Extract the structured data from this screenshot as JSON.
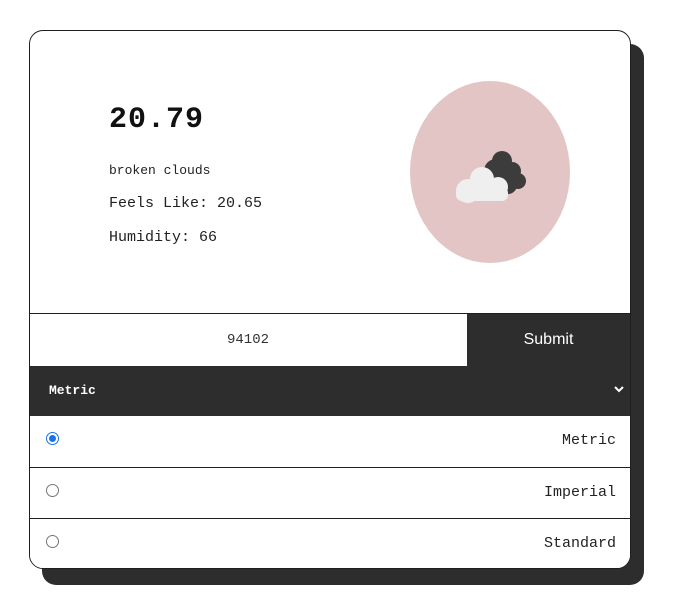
{
  "weather": {
    "temperature": "20.79",
    "description": "broken clouds",
    "feels_like": "Feels Like: 20.65",
    "humidity": "Humidity: 66",
    "icon": "cloud-icon",
    "icon_bg_color": "#e3c5c6"
  },
  "search": {
    "zip_value": "94102",
    "submit_label": "Submit"
  },
  "units": {
    "selected": "Metric",
    "options": [
      {
        "label": "Metric",
        "checked": true
      },
      {
        "label": "Imperial",
        "checked": false
      },
      {
        "label": "Standard",
        "checked": false
      }
    ]
  },
  "colors": {
    "dark": "#2d2d2d",
    "accent_radio": "#1a73e8"
  }
}
